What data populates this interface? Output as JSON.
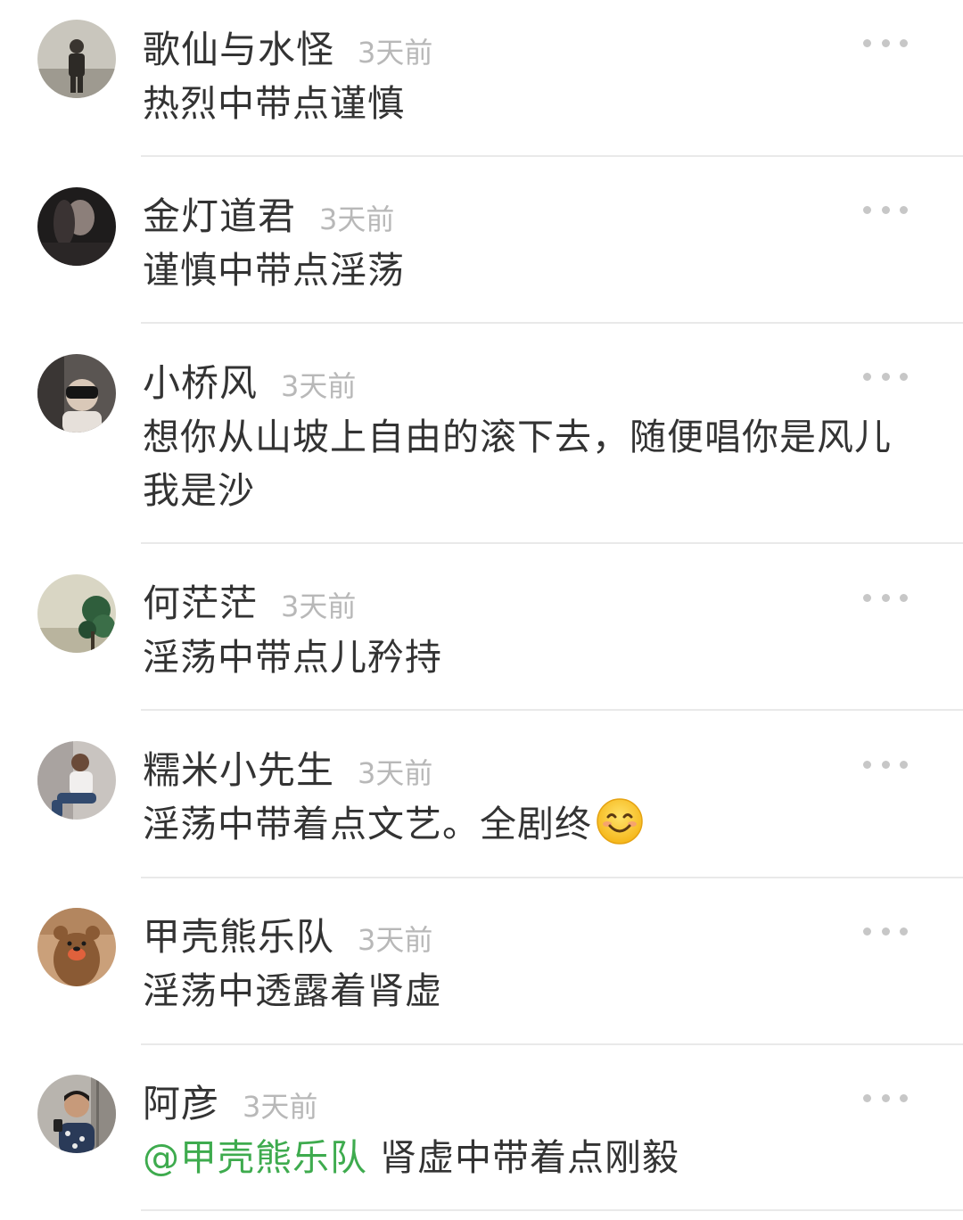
{
  "comments": [
    {
      "username": "歌仙与水怪",
      "time": "3天前",
      "text": "热烈中带点谨慎",
      "avatar_icon": "avatar-person-photo-icon"
    },
    {
      "username": "金灯道君",
      "time": "3天前",
      "text": "谨慎中带点淫荡",
      "avatar_icon": "avatar-dark-portrait-icon"
    },
    {
      "username": "小桥风",
      "time": "3天前",
      "text": "想你从山坡上自由的滚下去，随便唱你是风儿我是沙",
      "avatar_icon": "avatar-vr-headset-icon"
    },
    {
      "username": "何茫茫",
      "time": "3天前",
      "text": "淫荡中带点儿矜持",
      "avatar_icon": "avatar-tree-icon"
    },
    {
      "username": "糯米小先生",
      "time": "3天前",
      "text": "淫荡中带着点文艺。全剧终",
      "avatar_icon": "avatar-sitting-person-icon",
      "emoji": "smile-emoji-icon"
    },
    {
      "username": "甲壳熊乐队",
      "time": "3天前",
      "text": "淫荡中透露着肾虚",
      "avatar_icon": "avatar-cartoon-bear-icon"
    },
    {
      "username": "阿彦",
      "time": "3天前",
      "mention": "@甲壳熊乐队",
      "text": " 肾虚中带着点刚毅",
      "avatar_icon": "avatar-selfie-icon"
    }
  ],
  "colors": {
    "mention": "#3eab4e",
    "time": "#b8b8b8",
    "text": "#333333",
    "divider": "#e9e9e9"
  }
}
